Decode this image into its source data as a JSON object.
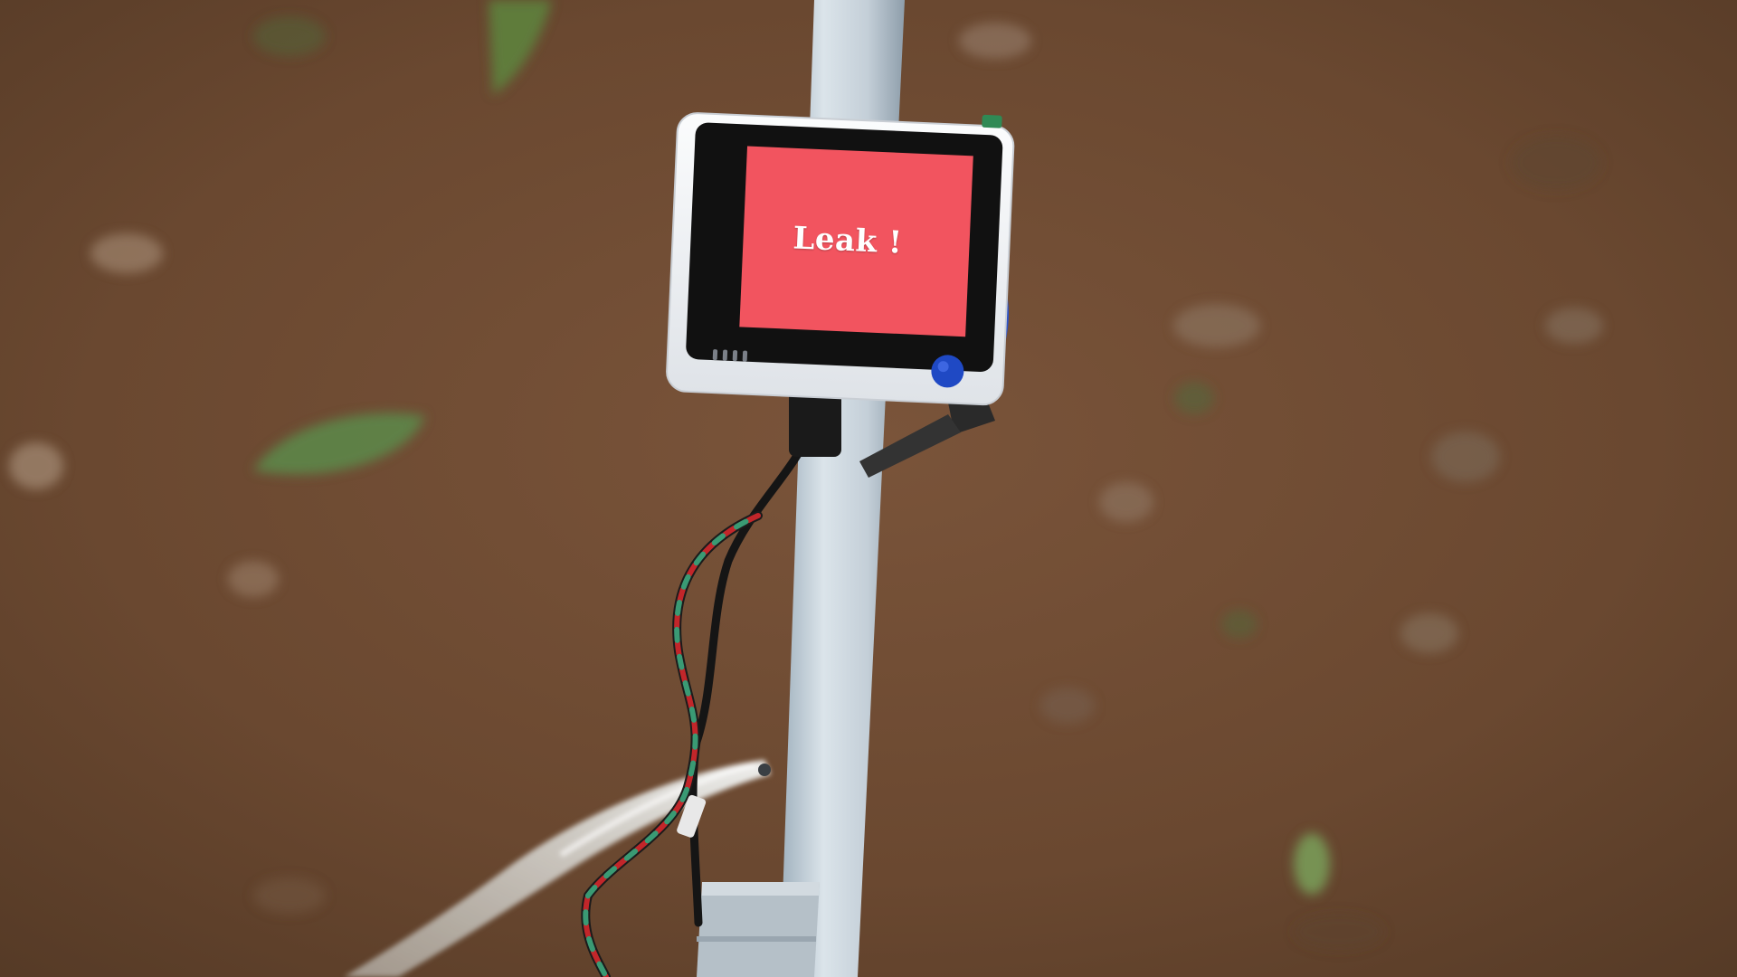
{
  "scene": {
    "description_free": true
  },
  "device": {
    "screen_text": "Leak !",
    "screen_color": "#f2545f",
    "bezel_color": "#111111",
    "case_color": "#f3f4f6",
    "button_color": "#1f49c4"
  },
  "colors": {
    "soil": "#6b4a33",
    "pipe": "#c9d4dc",
    "water": "#e6ebe9"
  }
}
